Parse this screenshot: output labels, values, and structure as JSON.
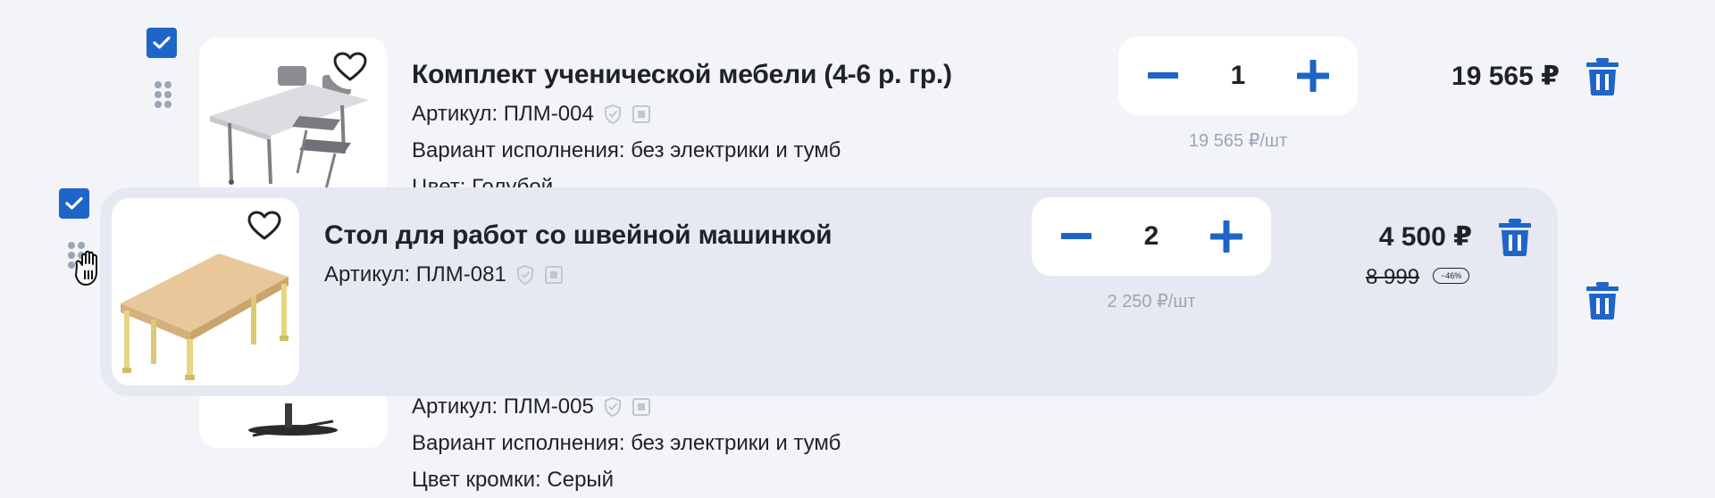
{
  "items": [
    {
      "title": "Комплект ученической мебели (4-6 р. гр.)",
      "article": "Артикул: ПЛМ-004",
      "variant": "Вариант исполнения: без электрики и тумб",
      "color": "Цвет: Голубой",
      "qty": "1",
      "unit_price": "19 565 ₽/шт",
      "price": "19 565 ₽"
    },
    {
      "title": "Стол для работ со швейной машинкой",
      "article": "Артикул: ПЛМ-081",
      "qty": "2",
      "unit_price": "2 250 ₽/шт",
      "price": "4 500 ₽",
      "old_price": "8 999",
      "discount": "−46%"
    },
    {
      "article": "Артикул: ПЛМ-005",
      "variant": "Вариант исполнения: без электрики и тумб",
      "edge_color": "Цвет кромки: Серый"
    }
  ],
  "icons": {
    "checkbox": "check-icon",
    "favorite": "heart-icon",
    "verified": "shield-check-icon",
    "qr": "square-code-icon",
    "minus": "minus-icon",
    "plus": "plus-icon",
    "delete": "trash-icon",
    "drag": "drag-handle-icon",
    "cursor": "grab-hand-icon"
  },
  "colors": {
    "accent": "#1f64c8",
    "muted": "#9aa5b6",
    "background": "#f3f4f8",
    "drag_overlay": "#e6e9f1"
  }
}
